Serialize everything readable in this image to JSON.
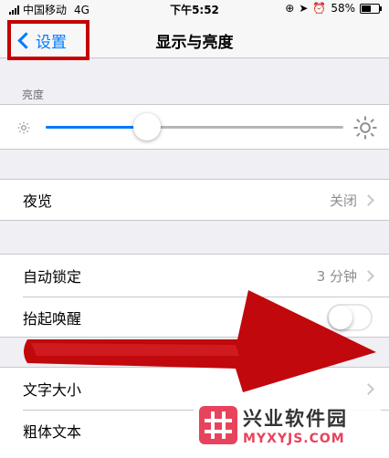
{
  "status_bar": {
    "carrier": "中国移动",
    "network": "4G",
    "time": "下午5:52",
    "battery": "58%",
    "battery_level": 0.58
  },
  "nav": {
    "back_label": "设置",
    "title": "显示与亮度"
  },
  "brightness": {
    "section_header": "亮度",
    "level": 0.34
  },
  "night_shift": {
    "label": "夜览",
    "value": "关闭"
  },
  "auto_lock": {
    "label": "自动锁定",
    "value": "3 分钟"
  },
  "raise_to_wake": {
    "label": "抬起唤醒",
    "enabled": false
  },
  "text_size": {
    "label": "文字大小"
  },
  "bold_text": {
    "label": "粗体文本"
  },
  "watermark": {
    "name": "兴业软件园",
    "url": "MYXYJS.COM"
  },
  "colors": {
    "accent": "#007aff",
    "highlight_box": "#c40000",
    "arrow": "#c0080d",
    "watermark": "#e8435c"
  }
}
